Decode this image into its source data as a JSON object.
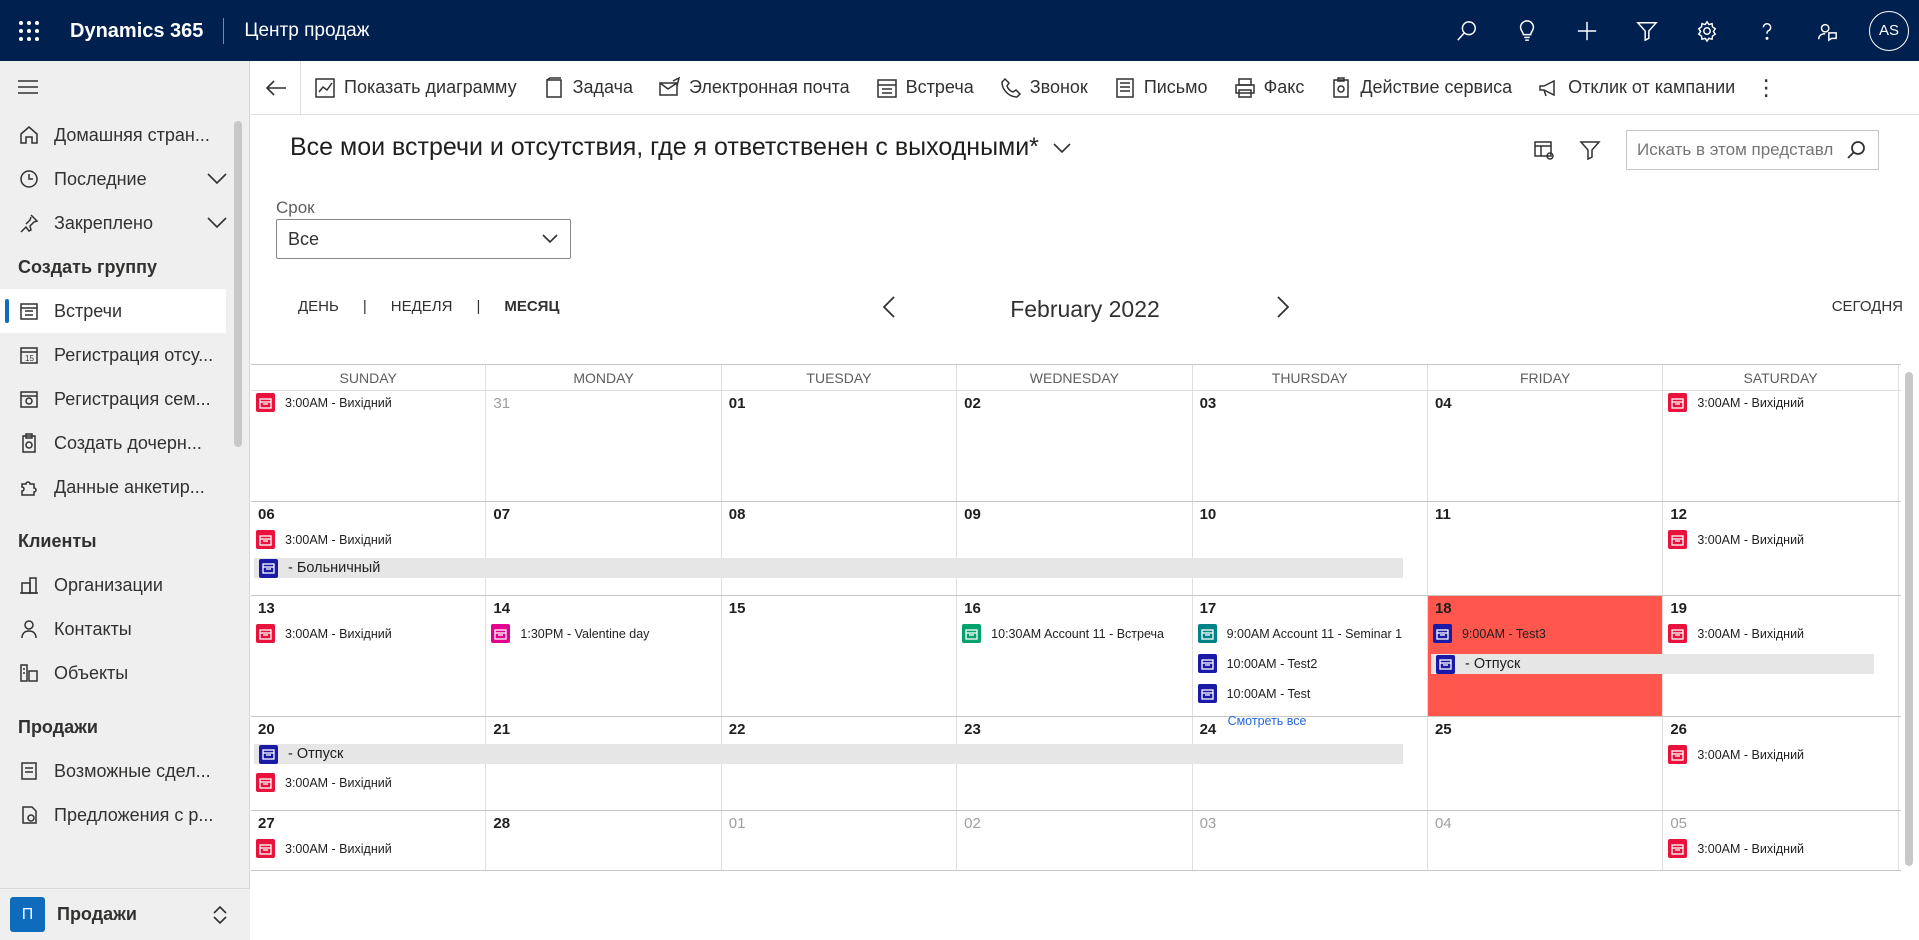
{
  "header": {
    "brand": "Dynamics 365",
    "app_name": "Центр продаж",
    "avatar_initials": "AS"
  },
  "sidebar": {
    "items": [
      {
        "label": "Домашняя стран...",
        "icon": "home-icon"
      },
      {
        "label": "Последние",
        "icon": "clock-icon"
      },
      {
        "label": "Закреплено",
        "icon": "pin-icon"
      }
    ],
    "group_create": "Создать группу",
    "create_items": [
      {
        "label": "Встречи",
        "icon": "calendar-icon"
      },
      {
        "label": "Регистрация отсу...",
        "icon": "calendar-absence-icon"
      },
      {
        "label": "Регистрация сем...",
        "icon": "calendar-family-icon"
      },
      {
        "label": "Создать дочерн...",
        "icon": "clipboard-icon"
      },
      {
        "label": "Данные анкетир...",
        "icon": "puzzle-icon"
      }
    ],
    "group_clients": "Клиенты",
    "client_items": [
      {
        "label": "Организации",
        "icon": "building-icon"
      },
      {
        "label": "Контакты",
        "icon": "person-icon"
      },
      {
        "label": "Объекты",
        "icon": "objects-icon"
      }
    ],
    "group_sales": "Продажи",
    "sales_items": [
      {
        "label": "Возможные сдел...",
        "icon": "document-icon"
      },
      {
        "label": "Предложения с р...",
        "icon": "document-offer-icon"
      }
    ],
    "area_badge": "П",
    "area_label": "Продажи"
  },
  "commands": {
    "show_chart": "Показать диаграмму",
    "task": "Задача",
    "email": "Электронная почта",
    "meeting": "Встреча",
    "call": "Звонок",
    "letter": "Письмо",
    "fax": "Факс",
    "service": "Действие сервиса",
    "campaign": "Отклик от кампании",
    "more": "⋮"
  },
  "view": {
    "title": "Все мои встречи и отсутствия, где я ответственен с выходными*",
    "search_placeholder": "Искать в этом представл"
  },
  "filter": {
    "label": "Срок",
    "value": "Все"
  },
  "calendar": {
    "tab_day": "ДЕНЬ",
    "tab_week": "НЕДЕЛЯ",
    "tab_month": "МЕСЯЦ",
    "sep": "|",
    "month": "February 2022",
    "today": "СЕГОДНЯ",
    "weekdays": [
      "SUNDAY",
      "MONDAY",
      "TUESDAY",
      "WEDNESDAY",
      "THURSDAY",
      "FRIDAY",
      "SATURDAY"
    ],
    "see_all": "Смотреть все",
    "colors": {
      "red": "#e8123d",
      "pink": "#e3008c",
      "teal": "#00a36c",
      "darkteal": "#038387",
      "navy": "#1a1aa6",
      "highlight": "#ff564d"
    },
    "weeks": [
      {
        "days": [
          "",
          "31",
          "01",
          "02",
          "03",
          "04",
          ""
        ],
        "events": [
          {
            "day": 0,
            "text": "3:00AM - Вихідний",
            "color": "red",
            "row": 0
          },
          {
            "day": 6,
            "text": "3:00AM - Вихідний",
            "color": "red",
            "row": 0
          }
        ]
      },
      {
        "days": [
          "06",
          "07",
          "08",
          "09",
          "10",
          "11",
          "12"
        ],
        "events": [
          {
            "day": 0,
            "text": "3:00AM - Вихідний",
            "color": "red",
            "row": 0
          },
          {
            "day": 6,
            "text": "3:00AM - Вихідний",
            "color": "red",
            "row": 0
          }
        ],
        "bars": [
          {
            "start": 0,
            "end": 4,
            "text": "- Больничный",
            "color": "navy"
          }
        ]
      },
      {
        "days": [
          "13",
          "14",
          "15",
          "16",
          "17",
          "18",
          "19"
        ],
        "events": [
          {
            "day": 0,
            "text": "3:00AM - Вихідний",
            "color": "red",
            "row": 0
          },
          {
            "day": 1,
            "text": "1:30PM - Valentine day",
            "color": "pink",
            "row": 0
          },
          {
            "day": 3,
            "text": "10:30AM Account 11 - Встреча",
            "color": "teal",
            "row": 0
          },
          {
            "day": 4,
            "text": "9:00AM Account 11 - Seminar 1",
            "color": "darkteal",
            "row": 0
          },
          {
            "day": 4,
            "text": "10:00AM - Test2",
            "color": "navy",
            "row": 1
          },
          {
            "day": 4,
            "text": "10:00AM - Test",
            "color": "navy",
            "row": 2
          },
          {
            "day": 5,
            "text": "9:00AM - Test3",
            "color": "navy",
            "row": 0
          },
          {
            "day": 6,
            "text": "3:00AM - Вихідний",
            "color": "red",
            "row": 0
          }
        ],
        "bars": [
          {
            "start": 5,
            "end": 6,
            "text": "- Отпуск",
            "color": "navy"
          }
        ]
      },
      {
        "days": [
          "20",
          "21",
          "22",
          "23",
          "24",
          "25",
          "26"
        ],
        "events": [
          {
            "day": 0,
            "text": "3:00AM - Вихідний",
            "color": "red",
            "row": 1
          },
          {
            "day": 6,
            "text": "3:00AM - Вихідний",
            "color": "red",
            "row": 0
          }
        ],
        "bars": [
          {
            "start": 0,
            "end": 4,
            "text": "- Отпуск",
            "color": "navy"
          }
        ]
      },
      {
        "days": [
          "27",
          "28",
          "01",
          "02",
          "03",
          "04",
          "05"
        ],
        "events": [
          {
            "day": 0,
            "text": "3:00AM - Вихідний",
            "color": "red",
            "row": 0
          },
          {
            "day": 6,
            "text": "3:00AM - Вихідний",
            "color": "red",
            "row": 0
          }
        ]
      }
    ]
  }
}
